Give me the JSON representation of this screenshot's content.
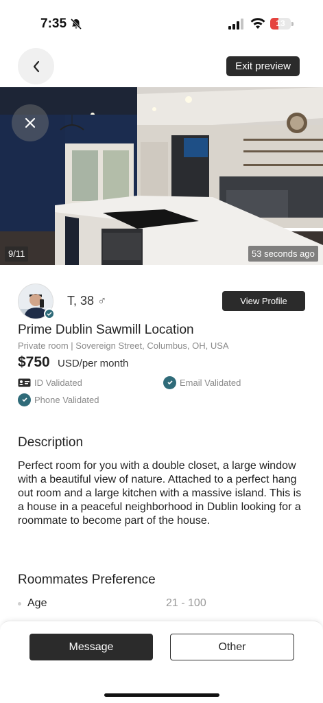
{
  "status_bar": {
    "time": "7:35",
    "battery": "13"
  },
  "nav": {
    "exit_preview_label": "Exit preview"
  },
  "photo": {
    "counter": "9/11",
    "posted_ago": "53 seconds ago"
  },
  "profile": {
    "name_age": "T, 38",
    "gender_symbol": "♂",
    "view_profile_label": "View Profile"
  },
  "listing": {
    "title": "Prime Dublin Sawmill Location",
    "subtitle": "Private room | Sovereign Street, Columbus, OH, USA",
    "price": "$750",
    "price_unit": "USD/per month"
  },
  "verifications": {
    "id": "ID Validated",
    "email": "Email Validated",
    "phone": "Phone Validated"
  },
  "description": {
    "heading": "Description",
    "text": "Perfect room for you with a double closet, a large window with a beautiful view of nature. Attached to a perfect hang out room and a large kitchen with a massive island. This is a house in a peaceful neighborhood in Dublin looking for a roommate to become part of the house."
  },
  "preferences": {
    "heading": "Roommates Preference",
    "items": [
      {
        "label": "Age",
        "value": "21 - 100"
      }
    ]
  },
  "actions": {
    "message_label": "Message",
    "other_label": "Other"
  },
  "colors": {
    "accent": "#2f6b79",
    "dark_button": "#2b2b2b",
    "battery_low": "#e5433f"
  }
}
